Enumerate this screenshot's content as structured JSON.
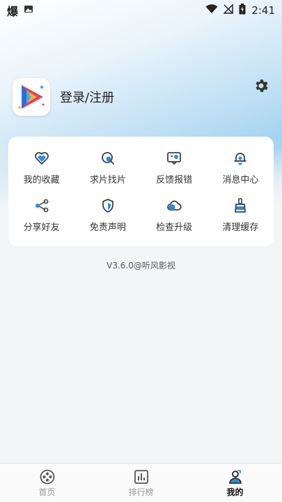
{
  "status_bar": {
    "app_glyph": "爆",
    "time": "2:41"
  },
  "profile": {
    "login_label": "登录/注册"
  },
  "menu": [
    {
      "label": "我的收藏",
      "icon": "heart-icon"
    },
    {
      "label": "求片找片",
      "icon": "search-film-icon"
    },
    {
      "label": "反馈报错",
      "icon": "feedback-icon"
    },
    {
      "label": "消息中心",
      "icon": "bell-icon"
    },
    {
      "label": "分享好友",
      "icon": "share-icon"
    },
    {
      "label": "免责声明",
      "icon": "shield-icon"
    },
    {
      "label": "检查升级",
      "icon": "cloud-upgrade-icon"
    },
    {
      "label": "清理缓存",
      "icon": "broom-icon"
    }
  ],
  "version": "V3.6.0@听风影视",
  "tabs": [
    {
      "label": "首页",
      "icon": "film-reel-icon"
    },
    {
      "label": "排行榜",
      "icon": "bar-chart-icon"
    },
    {
      "label": "我的",
      "icon": "profile-icon"
    }
  ],
  "colors": {
    "accent": "#2a8be0",
    "icon_stroke": "#3a3f4a"
  }
}
